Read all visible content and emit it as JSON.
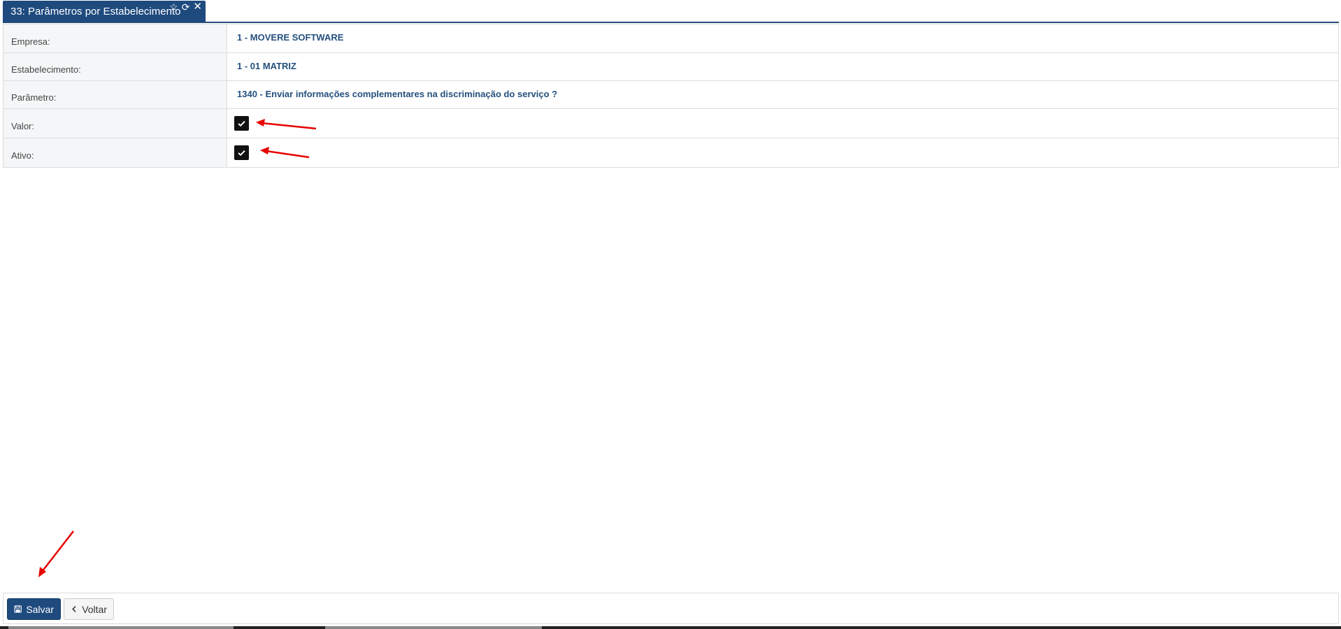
{
  "tab": {
    "title": "33: Parâmetros por Estabelecimento",
    "icons": [
      "star-icon",
      "refresh-icon",
      "close-icon"
    ]
  },
  "form": {
    "empresa": {
      "label": "Empresa:",
      "value": "1 - MOVERE SOFTWARE"
    },
    "estabelecimento": {
      "label": "Estabelecimento:",
      "value": "1 - 01 MATRIZ"
    },
    "parametro": {
      "label": "Parâmetro:",
      "value": "1340 - Enviar informações complementares na discriminação do serviço ?"
    },
    "valor": {
      "label": "Valor:",
      "checked": true
    },
    "ativo": {
      "label": "Ativo:",
      "checked": true
    }
  },
  "footer": {
    "save_label": "Salvar",
    "back_label": "Voltar"
  },
  "colors": {
    "primary": "#1e4a7e",
    "value_text": "#24507e",
    "annotation_arrow": "#e60000"
  }
}
